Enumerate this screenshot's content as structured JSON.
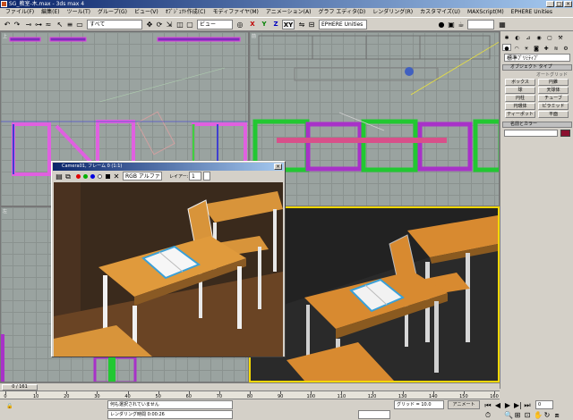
{
  "titlebar": {
    "title": "SG_教室-木.max - 3ds max 4"
  },
  "menu": [
    "ファイル(F)",
    "編集(E)",
    "ツール(T)",
    "グループ(G)",
    "ビュー(V)",
    "ｵﾌﾞｼﾞｪｸﾄ作成(C)",
    "モディファイヤ(M)",
    "アニメーション(A)",
    "グラフ エディタ(D)",
    "レンダリング(R)",
    "カスタマイズ(U)",
    "MAXScript(M)",
    "EPHERE Unities"
  ],
  "toolbar": {
    "selection_filter": "すべて",
    "ref_coord": "ビュー",
    "axis_labels": [
      "X",
      "Y",
      "Z",
      "XY"
    ],
    "named_selection": "EPHERE Unities"
  },
  "viewports": {
    "top": "上",
    "front": "前",
    "left": "左",
    "persp": "透視"
  },
  "command_panel": {
    "category": "標準ﾌﾟﾘﾐﾃｨﾌﾞ",
    "rollout_object_type": "オブジェクト タイプ",
    "autogrid": "オートグリッド",
    "buttons": [
      "ボックス",
      "円錐",
      "球",
      "天球体",
      "円柱",
      "チューブ",
      "円環体",
      "ピラミッド",
      "ティーポット",
      "平面"
    ],
    "rollout_name_color": "名前とカラー"
  },
  "render_window": {
    "title": "Camera01, フレーム 0 (1:1)",
    "channel": "RGB アルファ",
    "layer_label": "レイアー:",
    "layer_value": "1"
  },
  "timeline": {
    "frame_counter": "0 / 161",
    "ticks": [
      "0",
      "10",
      "20",
      "30",
      "40",
      "50",
      "60",
      "70",
      "80",
      "90",
      "100",
      "110",
      "120",
      "130",
      "140",
      "150",
      "160"
    ]
  },
  "status": {
    "selection": "何も選択されていません",
    "render_time": "レンダリング時間 0:00:26",
    "grid": "グリッド = 10.0",
    "anim": "アニメート",
    "time_config": "時間設定",
    "frame": "0"
  },
  "colors": {
    "accent": "#0a246a",
    "selection_yellow": "#f5d800",
    "magenta": "#a832c8",
    "green": "#22c832",
    "desk_wood": "#d89a3a"
  }
}
